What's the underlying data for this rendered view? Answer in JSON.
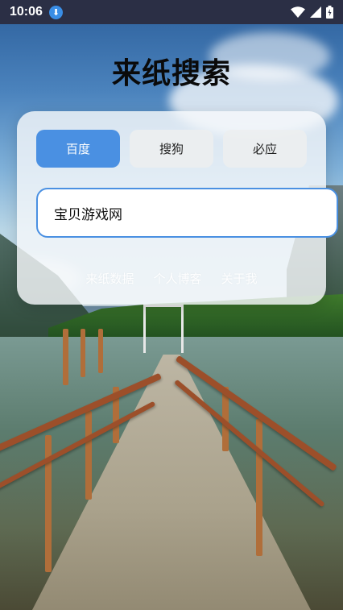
{
  "status_bar": {
    "time": "10:06"
  },
  "app": {
    "title": "来纸搜索"
  },
  "search": {
    "engines": [
      {
        "label": "百度",
        "active": true
      },
      {
        "label": "搜狗",
        "active": false
      },
      {
        "label": "必应",
        "active": false
      }
    ],
    "query": "宝贝游戏网"
  },
  "links": [
    {
      "label": "来纸数据"
    },
    {
      "label": "个人博客"
    },
    {
      "label": "关于我"
    }
  ],
  "colors": {
    "accent": "#4a90e2",
    "status_bar": "#2b2f45",
    "card": "#f5f8fa"
  },
  "icons": [
    "download-icon",
    "wifi-icon",
    "signal-icon",
    "battery-icon"
  ]
}
